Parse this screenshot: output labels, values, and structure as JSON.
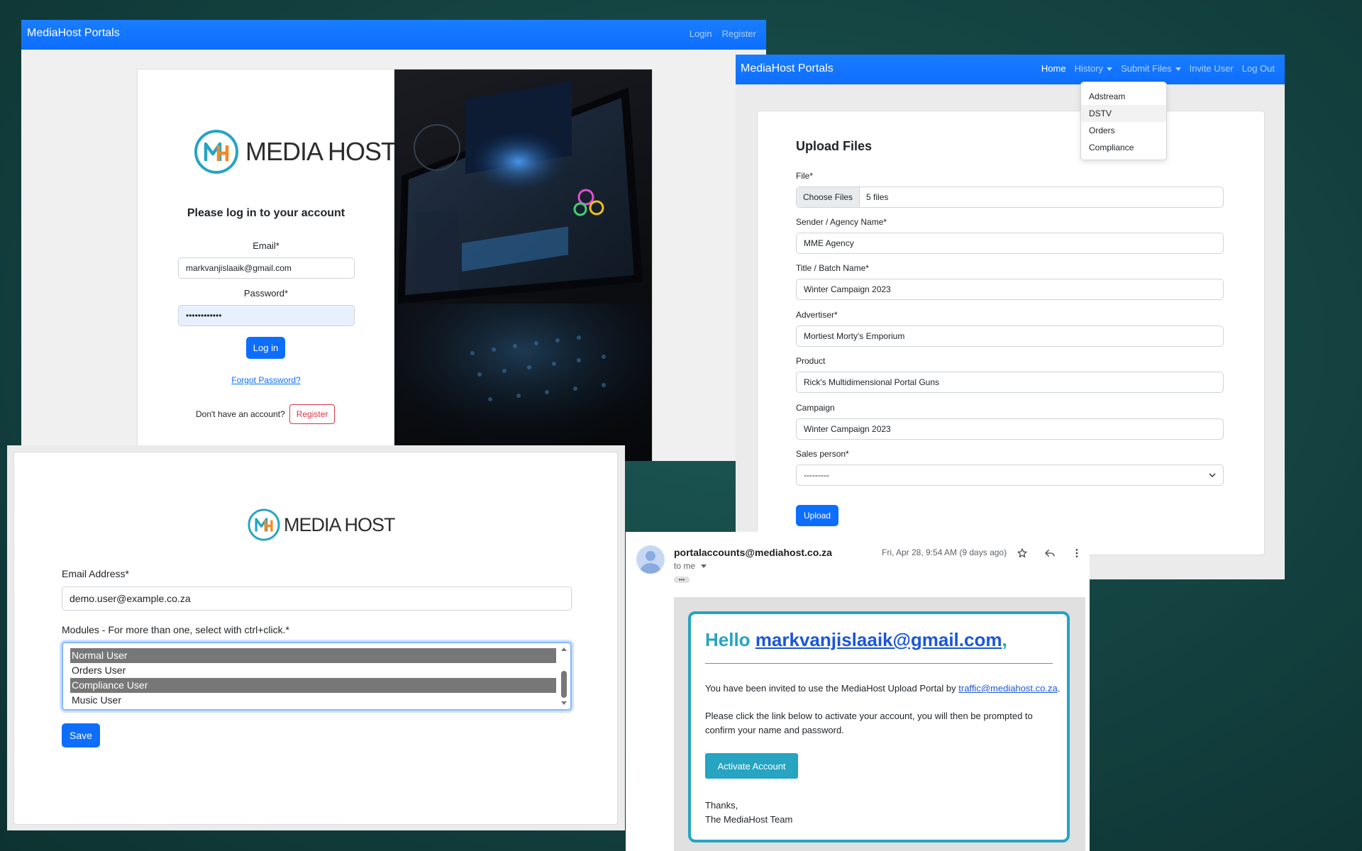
{
  "login_window": {
    "brand": "MediaHost Portals",
    "nav": [
      "Login",
      "Register"
    ],
    "logo_text": "MEDIA HOST",
    "logo_mark": "MH",
    "heading": "Please log in to your account",
    "email_label": "Email*",
    "email_value": "markvanjislaaik@gmail.com",
    "password_label": "Password*",
    "password_value": "••••••••••••",
    "login_button": "Log in",
    "forgot_link": "Forgot Password?",
    "no_account_text": "Don't have an account?",
    "register_button": "Register"
  },
  "upload_window": {
    "brand": "MediaHost Portals",
    "nav": {
      "home": "Home",
      "history": "History",
      "submit_files": "Submit Files",
      "invite_user": "Invite User",
      "log_out": "Log Out"
    },
    "dropdown": [
      "Adstream",
      "DSTV",
      "Orders",
      "Compliance"
    ],
    "title": "Upload Files",
    "file_label": "File*",
    "choose_files_button": "Choose Files",
    "files_selected": "5 files",
    "sender_label": "Sender / Agency Name*",
    "sender_value": "MME Agency",
    "title_label": "Title / Batch Name*",
    "title_value": "Winter Campaign 2023",
    "advertiser_label": "Advertiser*",
    "advertiser_value": "Mortiest Morty's Emporium",
    "product_label": "Product",
    "product_value": "Rick's Multidimensional Portal Guns",
    "campaign_label": "Campaign",
    "campaign_value": "Winter Campaign 2023",
    "sales_label": "Sales person*",
    "sales_value": "---------",
    "upload_button": "Upload"
  },
  "invite_window": {
    "logo_text": "MEDIA HOST",
    "logo_mark": "MH",
    "email_label": "Email Address*",
    "email_value": "demo.user@example.co.za",
    "modules_label": "Modules - For more than one, select with ctrl+click.*",
    "modules": [
      {
        "label": "Normal User",
        "selected": true
      },
      {
        "label": "Orders User",
        "selected": false
      },
      {
        "label": "Compliance User",
        "selected": true
      },
      {
        "label": "Music User",
        "selected": false
      }
    ],
    "save_button": "Save"
  },
  "email_window": {
    "sender": "portalaccounts@mediahost.co.za",
    "date": "Fri, Apr 28, 9:54 AM (9 days ago)",
    "to": "to me",
    "ellipsis": "•••",
    "hello": "Hello",
    "hello_email": "markvanjislaaik@gmail.com",
    "comma": ",",
    "p1_text": "You have been invited to use the MediaHost Upload Portal by",
    "p1_link": "traffic@mediahost.co.za",
    "p1_end": ".",
    "p2_line1": "Please click the link below to activate your account, you will then be prompted to",
    "p2_line2": "confirm your name and password.",
    "activate_button": "Activate Account",
    "thanks": "Thanks,",
    "team": "The MediaHost Team"
  },
  "colors": {
    "primary": "#0d6efd",
    "teal": "#26a4c2",
    "danger": "#dc3545",
    "background": "#154644"
  }
}
